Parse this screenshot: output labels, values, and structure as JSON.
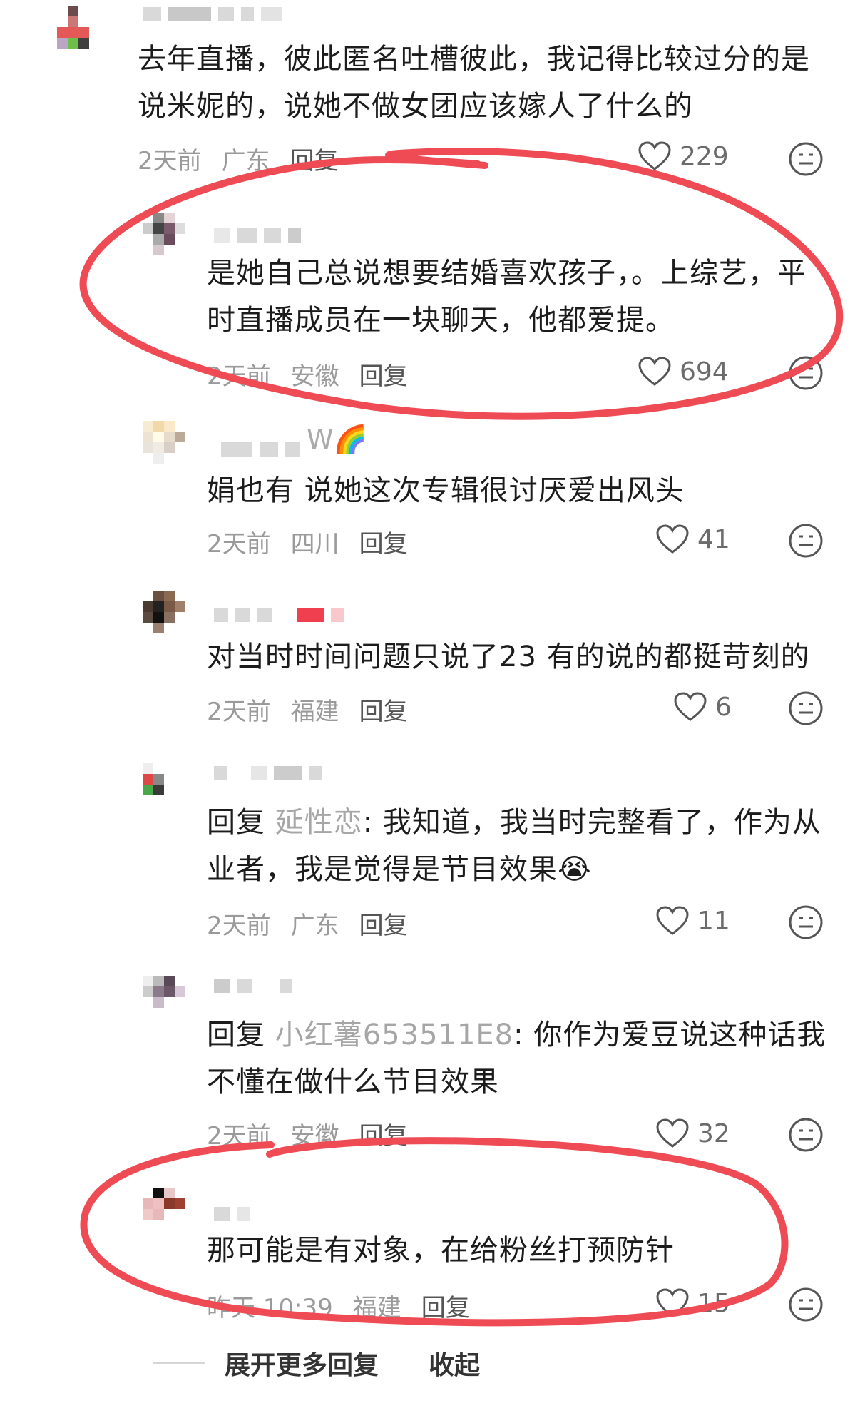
{
  "comments": [
    {
      "text": "去年直播，彼此匿名吐槽彼此，我记得比较过分的是\n说米妮的，说她不做女团应该嫁人了什么的",
      "time": "2天前",
      "location": "广东",
      "reply": "回复",
      "likes": "229"
    },
    {
      "text": "是她自己总说想要结婚喜欢孩子，。上综艺，平\n时直播成员在一块聊天，他都爱提。",
      "time": "2天前",
      "location": "安徽",
      "reply": "回复",
      "likes": "694"
    },
    {
      "username_suffix": "W🌈",
      "text": "娟也有 说她这次专辑很讨厌爱出风头",
      "time": "2天前",
      "location": "四川",
      "reply": "回复",
      "likes": "41"
    },
    {
      "text": "对当时时间问题只说了23 有的说的都挺苛刻的",
      "time": "2天前",
      "location": "福建",
      "reply": "回复",
      "likes": "6"
    },
    {
      "reply_prefix": "回复",
      "mention": "延性恋",
      "text": ": 我知道，我当时完整看了，作为从\n业者，我是觉得是节目效果😭",
      "time": "2天前",
      "location": "广东",
      "reply": "回复",
      "likes": "11"
    },
    {
      "reply_prefix": "回复",
      "mention": "小红薯653511E8",
      "text": ": 你作为爱豆说这种话我\n不懂在做什么节目效果",
      "time": "2天前",
      "location": "安徽",
      "reply": "回复",
      "likes": "32"
    },
    {
      "text": "那可能是有对象，在给粉丝打预防针",
      "time": "昨天 10:39",
      "location": "福建",
      "reply": "回复",
      "likes": "15"
    }
  ],
  "footer": {
    "expand": "展开更多回复",
    "collapse": "收起"
  },
  "colors": {
    "annotation": "#ef4b55",
    "meta": "#9a9a9a"
  },
  "icons": [
    "heart-icon",
    "emoji-face-icon"
  ]
}
